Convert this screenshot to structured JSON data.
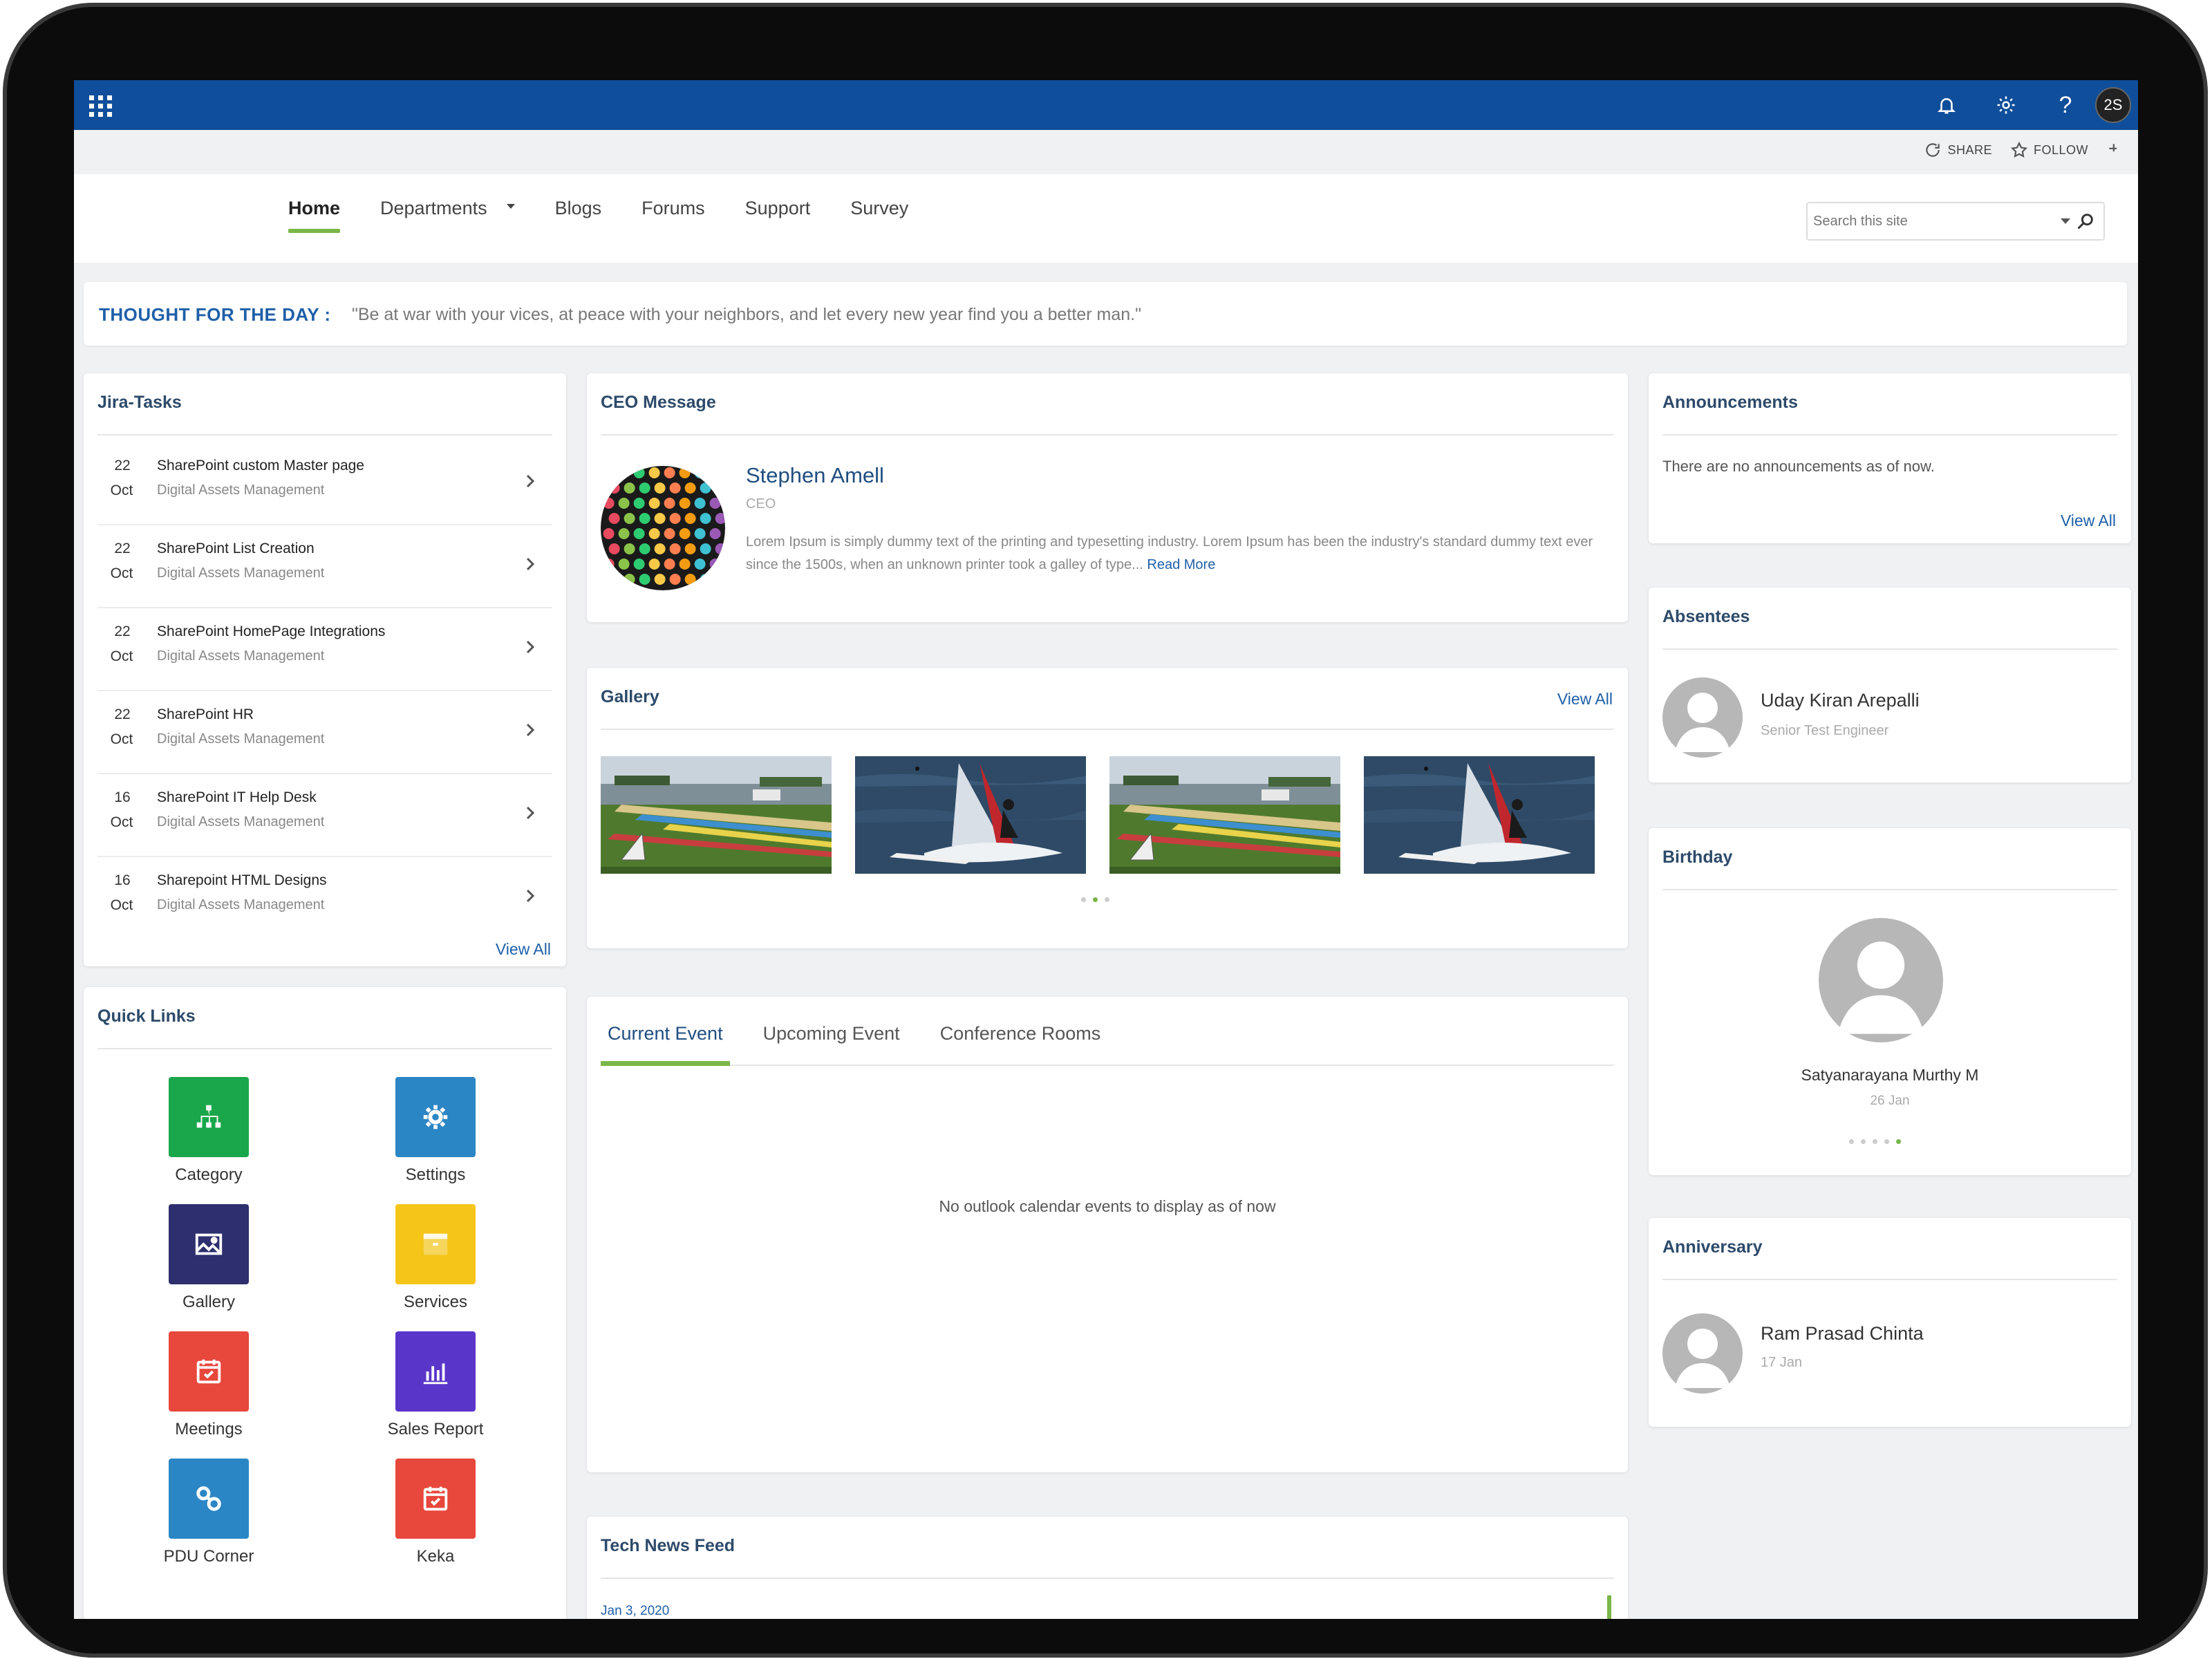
{
  "suite": {
    "help_label": "?",
    "user_initials": "2S"
  },
  "share_bar": {
    "share_label": "SHARE",
    "follow_label": "FOLLOW"
  },
  "nav": {
    "items": [
      "Home",
      "Departments",
      "Blogs",
      "Forums",
      "Support",
      "Survey"
    ],
    "active": "Home",
    "search_placeholder": "Search this site"
  },
  "thought": {
    "label": "THOUGHT FOR THE DAY :",
    "text": "\"Be at war with your vices, at peace with your neighbors, and let every new year find you a better man.\""
  },
  "jira": {
    "title": "Jira-Tasks",
    "tasks": [
      {
        "day": "22",
        "month": "Oct",
        "title": "SharePoint custom Master page",
        "sub": "Digital Assets Management"
      },
      {
        "day": "22",
        "month": "Oct",
        "title": "SharePoint List Creation",
        "sub": "Digital Assets Management"
      },
      {
        "day": "22",
        "month": "Oct",
        "title": "SharePoint HomePage Integrations",
        "sub": "Digital Assets Management"
      },
      {
        "day": "22",
        "month": "Oct",
        "title": "SharePoint HR",
        "sub": "Digital Assets Management"
      },
      {
        "day": "16",
        "month": "Oct",
        "title": "SharePoint IT Help Desk",
        "sub": "Digital Assets Management"
      },
      {
        "day": "16",
        "month": "Oct",
        "title": "Sharepoint HTML Designs",
        "sub": "Digital Assets Management"
      }
    ],
    "view_all": "View All"
  },
  "quick_links": {
    "title": "Quick Links",
    "items": [
      {
        "label": "Category",
        "color": "#1aa64a",
        "icon": "sitemap-icon"
      },
      {
        "label": "Settings",
        "color": "#2b86c5",
        "icon": "gear-icon"
      },
      {
        "label": "Gallery",
        "color": "#2d2f6e",
        "icon": "image-icon"
      },
      {
        "label": "Services",
        "color": "#f5c518",
        "icon": "box-icon"
      },
      {
        "label": "Meetings",
        "color": "#e8473b",
        "icon": "calendar-check-icon"
      },
      {
        "label": "Sales Report",
        "color": "#5a35c9",
        "icon": "bar-chart-icon"
      },
      {
        "label": "PDU Corner",
        "color": "#2b86c5",
        "icon": "link-icon"
      },
      {
        "label": "Keka",
        "color": "#e8473b",
        "icon": "calendar-check-icon"
      }
    ]
  },
  "ceo": {
    "title": "CEO Message",
    "name": "Stephen Amell",
    "role": "CEO",
    "message": "Lorem Ipsum is simply dummy text of the printing and typesetting industry. Lorem Ipsum has been the industry's standard dummy text ever since the 1500s, when an unknown printer took a galley of type...",
    "read_more": "Read More"
  },
  "gallery": {
    "title": "Gallery",
    "view_all": "View All",
    "images": [
      "beach-boards-image",
      "windsurfer-image",
      "beach-boards-image",
      "windsurfer-image"
    ],
    "dots": 3,
    "active_dot": 2
  },
  "events": {
    "tabs": [
      "Current Event",
      "Upcoming Event",
      "Conference Rooms"
    ],
    "active_tab": "Current Event",
    "empty_message": "No outlook calendar events to display as of now"
  },
  "news": {
    "title": "Tech News Feed",
    "first_date": "Jan 3, 2020"
  },
  "announcements": {
    "title": "Announcements",
    "message": "There are no announcements as of now.",
    "view_all": "View All"
  },
  "absentees": {
    "title": "Absentees",
    "name": "Uday Kiran Arepalli",
    "role": "Senior Test Engineer"
  },
  "birthday": {
    "title": "Birthday",
    "name": "Satyanarayana Murthy M",
    "date": "26 Jan",
    "dots": 5,
    "active_dot": 5
  },
  "anniversary": {
    "title": "Anniversary",
    "name": "Ram Prasad Chinta",
    "date": "17 Jan"
  },
  "colors": {
    "suite_bar": "#0f4e9a",
    "accent_green": "#7ab648",
    "link_blue": "#1f5fa8"
  }
}
